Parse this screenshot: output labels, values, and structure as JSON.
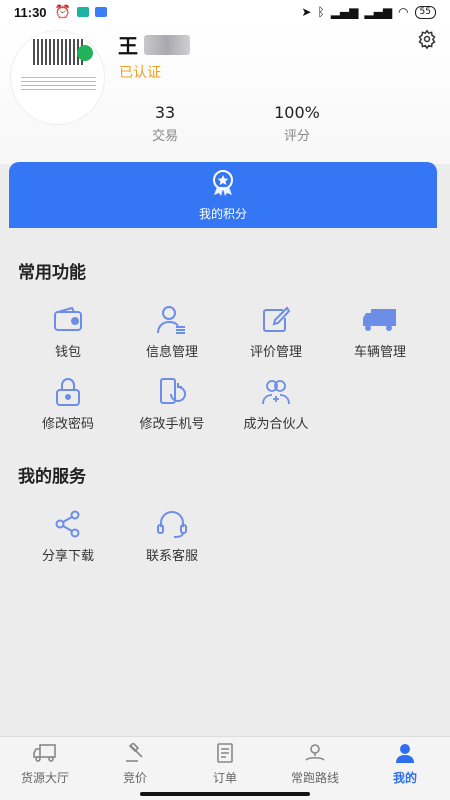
{
  "status": {
    "time": "11:30",
    "battery": "55"
  },
  "profile": {
    "name": "王",
    "verified": "已认证"
  },
  "stats": [
    {
      "value": "33",
      "label": "交易"
    },
    {
      "value": "100%",
      "label": "评分"
    }
  ],
  "points": {
    "label": "我的积分"
  },
  "common": {
    "title": "常用功能",
    "items": [
      {
        "label": "钱包",
        "icon": "wallet-icon"
      },
      {
        "label": "信息管理",
        "icon": "user-info-icon"
      },
      {
        "label": "评价管理",
        "icon": "edit-icon"
      },
      {
        "label": "车辆管理",
        "icon": "truck-icon"
      },
      {
        "label": "修改密码",
        "icon": "lock-icon"
      },
      {
        "label": "修改手机号",
        "icon": "phone-refresh-icon"
      },
      {
        "label": "成为合伙人",
        "icon": "partner-icon"
      }
    ]
  },
  "services": {
    "title": "我的服务",
    "items": [
      {
        "label": "分享下载",
        "icon": "share-icon"
      },
      {
        "label": "联系客服",
        "icon": "headset-icon"
      }
    ]
  },
  "nav": [
    {
      "label": "货源大厅",
      "icon": "truck-outline-icon"
    },
    {
      "label": "竞价",
      "icon": "gavel-icon"
    },
    {
      "label": "订单",
      "icon": "document-icon"
    },
    {
      "label": "常跑路线",
      "icon": "route-icon"
    },
    {
      "label": "我的",
      "icon": "person-icon",
      "active": true
    }
  ],
  "colors": {
    "accent": "#3476f3",
    "verified": "#f0a020",
    "icon": "#6d8ee8"
  }
}
